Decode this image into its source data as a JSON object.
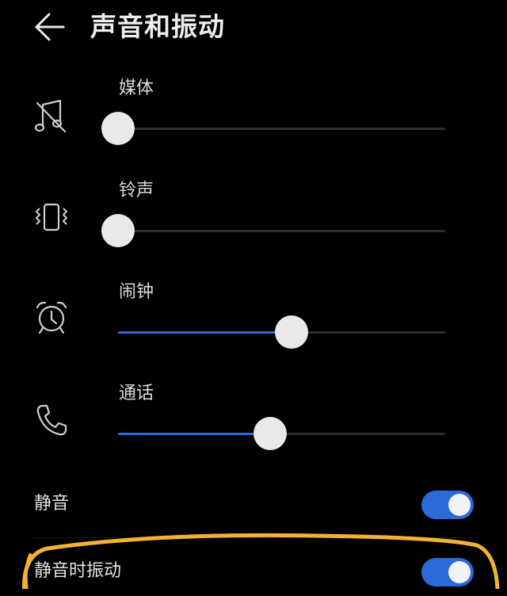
{
  "header": {
    "title": "声音和振动",
    "back_icon": "arrow-left-icon"
  },
  "volume": [
    {
      "label": "媒体",
      "icon": "music-muted-icon",
      "level": 0.0
    },
    {
      "label": "铃声",
      "icon": "vibrate-icon",
      "level": 0.0
    },
    {
      "label": "闹钟",
      "icon": "alarm-clock-icon",
      "level": 0.53
    },
    {
      "label": "通话",
      "icon": "phone-icon",
      "level": 0.465
    }
  ],
  "toggles": [
    {
      "label": "静音",
      "on": true
    },
    {
      "label": "静音时振动",
      "on": true
    }
  ],
  "colors": {
    "accent": "#2b6ad8",
    "background": "#000000",
    "highlight": "#f2b233"
  }
}
